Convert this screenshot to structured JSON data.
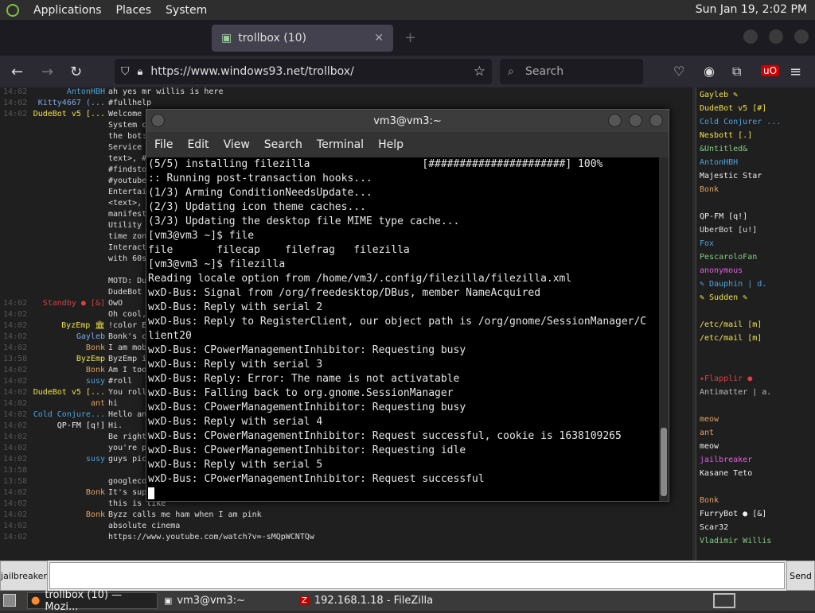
{
  "topbar": {
    "menus": [
      "Applications",
      "Places",
      "System"
    ],
    "clock": "Sun Jan 19,  2:02 PM"
  },
  "browser": {
    "tabs": [
      {
        "label": "trollbox (10)",
        "active": true
      }
    ],
    "url": "https://www.windows93.net/trollbox/",
    "search_placeholder": "Search"
  },
  "chat": {
    "messages": [
      {
        "time": "14:02",
        "nick": "AntonHBH",
        "color": "#4aa3df",
        "text": "ah yes mr willis is here"
      },
      {
        "time": "14:02",
        "nick": "Kitty4667 (...",
        "color": "#7fa8e8",
        "text": "#fullhelp"
      },
      {
        "time": "14:02",
        "nick": "DudeBot v5 [...",
        "color": "#f0e04a",
        "text": "Welcome"
      },
      {
        "time": "",
        "nick": "",
        "color": "#ddd",
        "text": "System c"
      },
      {
        "time": "",
        "nick": "",
        "color": "#ddd",
        "text": "the bot:"
      },
      {
        "time": "",
        "nick": "",
        "color": "#ddd",
        "text": "Service"
      },
      {
        "time": "",
        "nick": "",
        "color": "#ddd",
        "text": "text>, #"
      },
      {
        "time": "",
        "nick": "",
        "color": "#ddd",
        "text": "#findsto"
      },
      {
        "time": "",
        "nick": "",
        "color": "#ddd",
        "text": "#youtube"
      },
      {
        "time": "",
        "nick": "",
        "color": "#ddd",
        "text": "Entertai"
      },
      {
        "time": "",
        "nick": "",
        "color": "#ddd",
        "text": "<text>,"
      },
      {
        "time": "",
        "nick": "",
        "color": "#ddd",
        "text": "manifest"
      },
      {
        "time": "",
        "nick": "",
        "color": "#ddd",
        "text": "Utility"
      },
      {
        "time": "",
        "nick": "",
        "color": "#ddd",
        "text": "time zon"
      },
      {
        "time": "",
        "nick": "",
        "color": "#ddd",
        "text": "Interact"
      },
      {
        "time": "",
        "nick": "",
        "color": "#ddd",
        "text": "with 60s"
      },
      {
        "time": "",
        "nick": "",
        "color": "#ddd",
        "text": ""
      },
      {
        "time": "",
        "nick": "",
        "color": "#ddd",
        "text": "MOTD: Du"
      },
      {
        "time": "",
        "nick": "",
        "color": "#ddd",
        "text": "DudeBot"
      },
      {
        "time": "14:02",
        "nick": "Standby ● [&]",
        "color": "#d94040",
        "text": "OwO"
      },
      {
        "time": "14:02",
        "nick": "",
        "color": "#4040c0",
        "text": "Oh cool,"
      },
      {
        "time": "14:02",
        "nick": "ByzEmp 🏛",
        "color": "#f0e04a",
        "text": "!color E"
      },
      {
        "time": "14:02",
        "nick": "Gayleb",
        "color": "#7fa8e8",
        "text": "Bonk's c"
      },
      {
        "time": "14:02",
        "nick": "Bonk",
        "color": "#e0a060",
        "text": "I am mob"
      },
      {
        "time": "13:58",
        "nick": "ByzEmp",
        "color": "#f0e04a",
        "text": "ByzEmp i"
      },
      {
        "time": "14:02",
        "nick": "Bonk",
        "color": "#e0a060",
        "text": "Am I too"
      },
      {
        "time": "14:02",
        "nick": "susy",
        "color": "#4aa3df",
        "text": "#roll"
      },
      {
        "time": "14:02",
        "nick": "DudeBot v5 [...",
        "color": "#f0e04a",
        "text": "You roll"
      },
      {
        "time": "14:02",
        "nick": "ant",
        "color": "#e0a060",
        "text": "hi"
      },
      {
        "time": "14:02",
        "nick": "Cold Conjure...",
        "color": "#4aa3df",
        "text": "Hello an"
      },
      {
        "time": "14:02",
        "nick": "QP-FM [q!]",
        "color": "#eeeeee",
        "text": "Hi."
      },
      {
        "time": "14:02",
        "nick": "",
        "color": "#4040c0",
        "text": "Be right"
      },
      {
        "time": "14:02",
        "nick": "",
        "color": "#c03030",
        "text": "you're p"
      },
      {
        "time": "14:02",
        "nick": "susy",
        "color": "#4aa3df",
        "text": "guys pic"
      },
      {
        "time": "13:58",
        "nick": "",
        "color": "#c03030",
        "text": ""
      },
      {
        "time": "13:58",
        "nick": "",
        "color": "#c03030",
        "text": "googleco"
      },
      {
        "time": "14:02",
        "nick": "Bonk",
        "color": "#e0a060",
        "text": "It's supposed to be coral but pinker"
      },
      {
        "time": "14:02",
        "nick": "",
        "color": "#c03030",
        "text": "this is like"
      },
      {
        "time": "14:02",
        "nick": "Bonk",
        "color": "#e0a060",
        "text": "Byzz calls me ham when I am pink"
      },
      {
        "time": "14:02",
        "nick": "",
        "color": "#c03030",
        "text": "absolute cinema"
      },
      {
        "time": "14:02",
        "nick": "",
        "color": "#c03030",
        "text": "https://www.youtube.com/watch?v=-sMQpWCNTQw"
      }
    ],
    "users": [
      {
        "name": "Gayleb ✎",
        "color": "#f0e04a"
      },
      {
        "name": "DudeBot v5 [#]",
        "color": "#f0e04a"
      },
      {
        "name": "Cold Conjurer ...",
        "color": "#4aa3df"
      },
      {
        "name": "Nesbott [.]",
        "color": "#f0e04a"
      },
      {
        "name": "&Untitled&",
        "color": "#7fd07f"
      },
      {
        "name": "AntonHBH",
        "color": "#4aa3df"
      },
      {
        "name": "Majestic Star",
        "color": "#eeeeee"
      },
      {
        "name": "Bonk",
        "color": "#e0a060"
      },
      {
        "name": "",
        "color": "#4a9a4a"
      },
      {
        "name": "QP-FM [q!]",
        "color": "#eeeeee"
      },
      {
        "name": "UberBot [u!]",
        "color": "#dddddd"
      },
      {
        "name": "Fox",
        "color": "#4aa3df"
      },
      {
        "name": "PescaroloFan",
        "color": "#7fd07f"
      },
      {
        "name": "anonymous",
        "color": "#e060e0"
      },
      {
        "name": "✎ Dauphin | d.",
        "color": "#4aa3df"
      },
      {
        "name": "✎ Sudden ✎",
        "color": "#f0e04a"
      },
      {
        "name": "",
        "color": "#4040c0"
      },
      {
        "name": "/etc/mail [m]",
        "color": "#f0e04a"
      },
      {
        "name": "/etc/mail [m]",
        "color": "#f0e04a"
      },
      {
        "name": "",
        "color": "#4040c0"
      },
      {
        "name": "",
        "color": "#4a9a4a"
      },
      {
        "name": "✦Flapplir ●",
        "color": "#d94040"
      },
      {
        "name": "Antimatter | a.",
        "color": "#bbbbbb"
      },
      {
        "name": "",
        "color": "#c03030"
      },
      {
        "name": "meow",
        "color": "#e0a060"
      },
      {
        "name": "ant",
        "color": "#e0a060"
      },
      {
        "name": "meow",
        "color": "#eeeeee"
      },
      {
        "name": "jailbreaker",
        "color": "#e060e0"
      },
      {
        "name": "Kasane Teto",
        "color": "#eeeeee"
      },
      {
        "name": "",
        "color": "#4040c0"
      },
      {
        "name": "Bonk",
        "color": "#e0a060"
      },
      {
        "name": "FurryBot ● [&]",
        "color": "#eeeeee"
      },
      {
        "name": "Scar32",
        "color": "#eeeeee"
      },
      {
        "name": "Vladimir Willis",
        "color": "#7fd07f"
      }
    ],
    "nick_button": "jailbreaker",
    "send_button": "Send"
  },
  "terminal": {
    "title": "vm3@vm3:~",
    "menu": [
      "File",
      "Edit",
      "View",
      "Search",
      "Terminal",
      "Help"
    ],
    "lines": [
      "(5/5) installing filezilla                  [######################] 100%",
      ":: Running post-transaction hooks...",
      "(1/3) Arming ConditionNeedsUpdate...",
      "(2/3) Updating icon theme caches...",
      "(3/3) Updating the desktop file MIME type cache...",
      "[vm3@vm3 ~]$ file",
      "file       filecap    filefrag   filezilla",
      "[vm3@vm3 ~]$ filezilla",
      "Reading locale option from /home/vm3/.config/filezilla/filezilla.xml",
      "wxD-Bus: Signal from /org/freedesktop/DBus, member NameAcquired",
      "wxD-Bus: Reply with serial 2",
      "wxD-Bus: Reply to RegisterClient, our object path is /org/gnome/SessionManager/C",
      "lient20",
      "wxD-Bus: CPowerManagementInhibitor: Requesting busy",
      "wxD-Bus: Reply with serial 3",
      "wxD-Bus: Reply: Error: The name is not activatable",
      "wxD-Bus: Falling back to org.gnome.SessionManager",
      "wxD-Bus: CPowerManagementInhibitor: Requesting busy",
      "wxD-Bus: Reply with serial 4",
      "wxD-Bus: CPowerManagementInhibitor: Request successful, cookie is 1638109265",
      "wxD-Bus: CPowerManagementInhibitor: Requesting idle",
      "wxD-Bus: Reply with serial 5",
      "wxD-Bus: CPowerManagementInhibitor: Request successful"
    ]
  },
  "taskbar": {
    "items": [
      {
        "label": "trollbox (10) — Mozi...",
        "icon": "firefox-icon"
      },
      {
        "label": "vm3@vm3:~",
        "icon": "terminal-icon"
      },
      {
        "label": "192.168.1.18 - FileZilla",
        "icon": "filezilla-icon"
      }
    ]
  }
}
